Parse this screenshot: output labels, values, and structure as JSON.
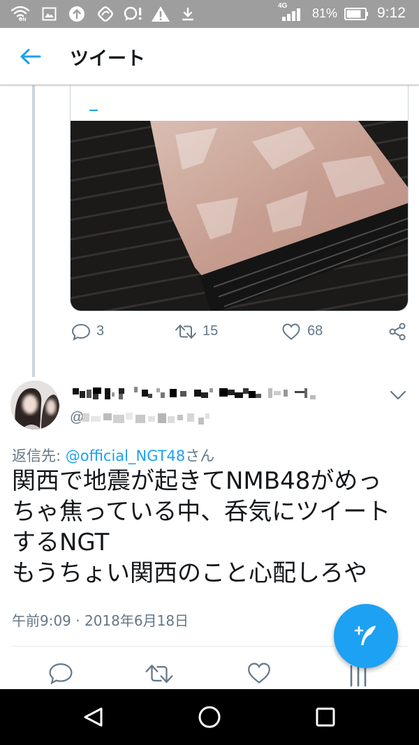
{
  "status_bar": {
    "wifi_call_label": "ON",
    "network_type": "4G",
    "battery_level": "81%",
    "time": "9:12",
    "icons": [
      "wifi-calling-icon",
      "image-icon",
      "upload-icon",
      "app-icon",
      "chat-alert-icon",
      "warning-icon",
      "download-icon",
      "signal-icon",
      "battery-icon"
    ]
  },
  "app_bar": {
    "title": "ツイート",
    "back_icon": "arrow-left-icon"
  },
  "parent_tweet": {
    "replies": "3",
    "retweets": "15",
    "likes": "68",
    "action_icons": [
      "reply-icon",
      "retweet-icon",
      "like-icon",
      "share-icon"
    ]
  },
  "tweet": {
    "handle_prefix": "@",
    "reply_prefix": "返信先: ",
    "reply_to": "@official_NGT48",
    "reply_suffix": "さん",
    "text_lines": [
      "関西で地震が起きてNMB48がめっ",
      "ちゃ焦っている中、呑気にツイート",
      "するNGT",
      "もうちょい関西のこと心配しろや"
    ],
    "timestamp": "午前9:09 · 2018年6月18日",
    "action_icons": [
      "reply-icon",
      "retweet-icon",
      "like-icon",
      "analytics-icon"
    ],
    "menu_icon": "chevron-down-icon"
  },
  "fab": {
    "icon": "compose-tweet-icon"
  },
  "nav_bar": {
    "icons": [
      "back-icon",
      "home-icon",
      "recents-icon"
    ]
  },
  "colors": {
    "accent": "#1da1f2",
    "text": "#14171a",
    "secondary_text": "#657786",
    "status_bar": "#9e9e9e",
    "nav_bar": "#000000"
  }
}
